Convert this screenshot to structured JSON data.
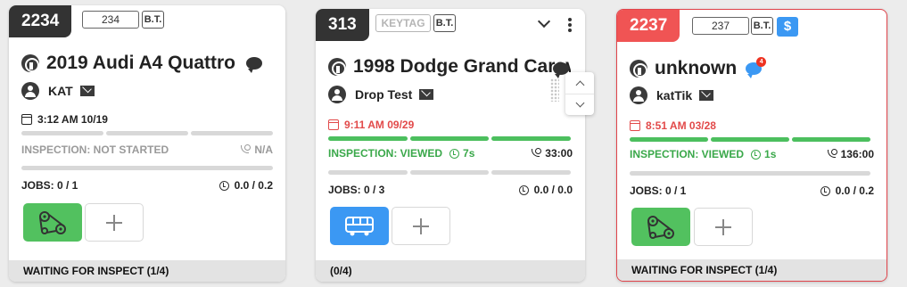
{
  "cards": [
    {
      "ro_number": "2234",
      "tag": "234",
      "bt_label": "B.T.",
      "vehicle": "2019 Audi A4 Quattro",
      "customer": "KAT",
      "time": "3:12 AM 10/19",
      "inspection_status": "INSPECTION: NOT STARTED",
      "call_time": "N/A",
      "jobs": "JOBS: 0 / 1",
      "hours": "0.0 / 0.2",
      "job_icon": "timing-belt-icon",
      "footer": "WAITING FOR INSPECT (1/4)",
      "inspection_progress": 0
    },
    {
      "ro_number": "313",
      "tag": "KEYTAG",
      "bt_label": "B.T.",
      "vehicle": "1998 Dodge Grand Caravan",
      "customer": "Drop Test",
      "time": "9:11 AM 09/29",
      "inspection_status": "INSPECTION: VIEWED",
      "viewed_duration": "7s",
      "call_time": "33:00",
      "jobs": "JOBS: 0 / 3",
      "hours": "0.0 / 0.0",
      "job_icon": "bus-icon",
      "footer": "(0/4)",
      "inspection_progress": 1
    },
    {
      "ro_number": "2237",
      "tag": "237",
      "bt_label": "B.T.",
      "dollar": "$",
      "vehicle": "unknown",
      "chat_badge": "4",
      "customer": "katTik",
      "time": "8:51 AM 03/28",
      "inspection_status": "INSPECTION: VIEWED",
      "viewed_duration": "1s",
      "call_time": "136:00",
      "jobs": "JOBS: 0 / 1",
      "hours": "0.0 / 0.2",
      "job_icon": "timing-belt-icon",
      "footer": "WAITING FOR INSPECT (1/4)",
      "inspection_progress": 1
    }
  ],
  "colors": {
    "ro_dark": "#333333",
    "ro_alert": "#f05454",
    "progress_done": "#4cbf5e",
    "progress_empty": "#d8d8d8",
    "job_green": "#52c15f",
    "job_blue": "#3b98f3",
    "overdue_time": "#e24a4a"
  }
}
